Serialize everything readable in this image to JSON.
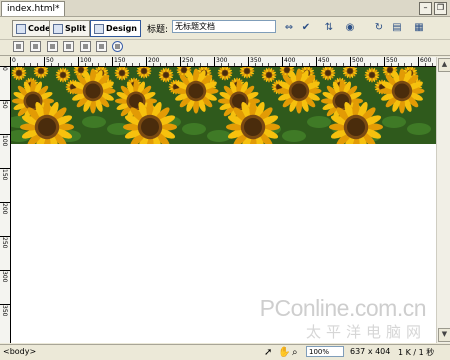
{
  "document": {
    "tab_label": "index.html*"
  },
  "window_controls": [
    "minimize-icon",
    "maximize-icon"
  ],
  "toolbar": {
    "modes": [
      {
        "label": "Code",
        "icon": "code-view-icon",
        "active": false
      },
      {
        "label": "Split",
        "icon": "split-view-icon",
        "active": false
      },
      {
        "label": "Design",
        "icon": "design-view-icon",
        "active": true
      }
    ],
    "title_label": "标题:",
    "title_value": "无标题文档",
    "icons": [
      "browser-check-icon",
      "validate-icon",
      "file-management-icon",
      "preview-globe-icon",
      "refresh-icon",
      "view-options-icon",
      "visual-aids-icon"
    ]
  },
  "insert_toolbar": {
    "icons": [
      "layout-table-icon",
      "page-icon",
      "stack-icon",
      "monitor-icon",
      "form-icon",
      "toolbox-icon",
      "no-entry-icon"
    ]
  },
  "rulers": {
    "horizontal_labels": [
      "0",
      "50",
      "100",
      "150",
      "200",
      "250",
      "300",
      "350",
      "400",
      "450",
      "500",
      "550",
      "600"
    ],
    "vertical_labels": [
      "0",
      "50",
      "100",
      "150",
      "200",
      "250",
      "300",
      "350"
    ]
  },
  "canvas": {
    "image_description_icon": "sunflower-banner-image",
    "colors": {
      "petal": "#f6c10e",
      "petal_dark": "#e29b05",
      "center": "#4a2c0c",
      "center_ring": "#7a4a12",
      "leaf": "#3f7a26",
      "sky_bg": "#2f5a1c"
    }
  },
  "status": {
    "tag_path": "<body>",
    "zoom": "100%",
    "dimensions": "637 x 404",
    "file_info": "1 K / 1 秒"
  },
  "watermark": {
    "brand": "PConline.com.cn",
    "sub": "太平洋电脑网"
  }
}
